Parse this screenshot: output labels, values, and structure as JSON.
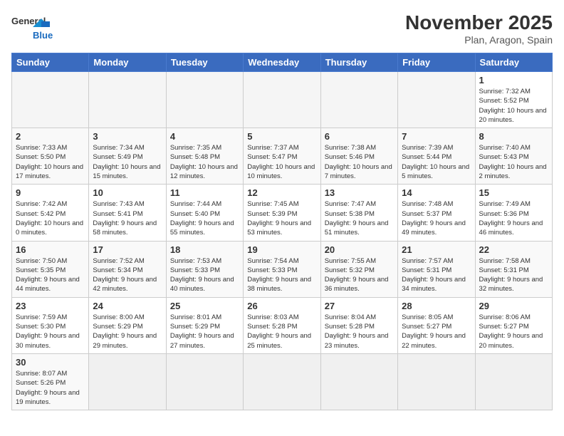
{
  "header": {
    "logo_general": "General",
    "logo_blue": "Blue",
    "title": "November 2025",
    "subtitle": "Plan, Aragon, Spain"
  },
  "days_of_week": [
    "Sunday",
    "Monday",
    "Tuesday",
    "Wednesday",
    "Thursday",
    "Friday",
    "Saturday"
  ],
  "weeks": [
    {
      "days": [
        {
          "num": "",
          "info": "",
          "empty": true
        },
        {
          "num": "",
          "info": "",
          "empty": true
        },
        {
          "num": "",
          "info": "",
          "empty": true
        },
        {
          "num": "",
          "info": "",
          "empty": true
        },
        {
          "num": "",
          "info": "",
          "empty": true
        },
        {
          "num": "",
          "info": "",
          "empty": true
        },
        {
          "num": "1",
          "info": "Sunrise: 7:32 AM\nSunset: 5:52 PM\nDaylight: 10 hours and 20 minutes.",
          "empty": false
        }
      ]
    },
    {
      "days": [
        {
          "num": "2",
          "info": "Sunrise: 7:33 AM\nSunset: 5:50 PM\nDaylight: 10 hours and 17 minutes.",
          "empty": false
        },
        {
          "num": "3",
          "info": "Sunrise: 7:34 AM\nSunset: 5:49 PM\nDaylight: 10 hours and 15 minutes.",
          "empty": false
        },
        {
          "num": "4",
          "info": "Sunrise: 7:35 AM\nSunset: 5:48 PM\nDaylight: 10 hours and 12 minutes.",
          "empty": false
        },
        {
          "num": "5",
          "info": "Sunrise: 7:37 AM\nSunset: 5:47 PM\nDaylight: 10 hours and 10 minutes.",
          "empty": false
        },
        {
          "num": "6",
          "info": "Sunrise: 7:38 AM\nSunset: 5:46 PM\nDaylight: 10 hours and 7 minutes.",
          "empty": false
        },
        {
          "num": "7",
          "info": "Sunrise: 7:39 AM\nSunset: 5:44 PM\nDaylight: 10 hours and 5 minutes.",
          "empty": false
        },
        {
          "num": "8",
          "info": "Sunrise: 7:40 AM\nSunset: 5:43 PM\nDaylight: 10 hours and 2 minutes.",
          "empty": false
        }
      ]
    },
    {
      "days": [
        {
          "num": "9",
          "info": "Sunrise: 7:42 AM\nSunset: 5:42 PM\nDaylight: 10 hours and 0 minutes.",
          "empty": false
        },
        {
          "num": "10",
          "info": "Sunrise: 7:43 AM\nSunset: 5:41 PM\nDaylight: 9 hours and 58 minutes.",
          "empty": false
        },
        {
          "num": "11",
          "info": "Sunrise: 7:44 AM\nSunset: 5:40 PM\nDaylight: 9 hours and 55 minutes.",
          "empty": false
        },
        {
          "num": "12",
          "info": "Sunrise: 7:45 AM\nSunset: 5:39 PM\nDaylight: 9 hours and 53 minutes.",
          "empty": false
        },
        {
          "num": "13",
          "info": "Sunrise: 7:47 AM\nSunset: 5:38 PM\nDaylight: 9 hours and 51 minutes.",
          "empty": false
        },
        {
          "num": "14",
          "info": "Sunrise: 7:48 AM\nSunset: 5:37 PM\nDaylight: 9 hours and 49 minutes.",
          "empty": false
        },
        {
          "num": "15",
          "info": "Sunrise: 7:49 AM\nSunset: 5:36 PM\nDaylight: 9 hours and 46 minutes.",
          "empty": false
        }
      ]
    },
    {
      "days": [
        {
          "num": "16",
          "info": "Sunrise: 7:50 AM\nSunset: 5:35 PM\nDaylight: 9 hours and 44 minutes.",
          "empty": false
        },
        {
          "num": "17",
          "info": "Sunrise: 7:52 AM\nSunset: 5:34 PM\nDaylight: 9 hours and 42 minutes.",
          "empty": false
        },
        {
          "num": "18",
          "info": "Sunrise: 7:53 AM\nSunset: 5:33 PM\nDaylight: 9 hours and 40 minutes.",
          "empty": false
        },
        {
          "num": "19",
          "info": "Sunrise: 7:54 AM\nSunset: 5:33 PM\nDaylight: 9 hours and 38 minutes.",
          "empty": false
        },
        {
          "num": "20",
          "info": "Sunrise: 7:55 AM\nSunset: 5:32 PM\nDaylight: 9 hours and 36 minutes.",
          "empty": false
        },
        {
          "num": "21",
          "info": "Sunrise: 7:57 AM\nSunset: 5:31 PM\nDaylight: 9 hours and 34 minutes.",
          "empty": false
        },
        {
          "num": "22",
          "info": "Sunrise: 7:58 AM\nSunset: 5:31 PM\nDaylight: 9 hours and 32 minutes.",
          "empty": false
        }
      ]
    },
    {
      "days": [
        {
          "num": "23",
          "info": "Sunrise: 7:59 AM\nSunset: 5:30 PM\nDaylight: 9 hours and 30 minutes.",
          "empty": false
        },
        {
          "num": "24",
          "info": "Sunrise: 8:00 AM\nSunset: 5:29 PM\nDaylight: 9 hours and 29 minutes.",
          "empty": false
        },
        {
          "num": "25",
          "info": "Sunrise: 8:01 AM\nSunset: 5:29 PM\nDaylight: 9 hours and 27 minutes.",
          "empty": false
        },
        {
          "num": "26",
          "info": "Sunrise: 8:03 AM\nSunset: 5:28 PM\nDaylight: 9 hours and 25 minutes.",
          "empty": false
        },
        {
          "num": "27",
          "info": "Sunrise: 8:04 AM\nSunset: 5:28 PM\nDaylight: 9 hours and 23 minutes.",
          "empty": false
        },
        {
          "num": "28",
          "info": "Sunrise: 8:05 AM\nSunset: 5:27 PM\nDaylight: 9 hours and 22 minutes.",
          "empty": false
        },
        {
          "num": "29",
          "info": "Sunrise: 8:06 AM\nSunset: 5:27 PM\nDaylight: 9 hours and 20 minutes.",
          "empty": false
        }
      ]
    },
    {
      "days": [
        {
          "num": "30",
          "info": "Sunrise: 8:07 AM\nSunset: 5:26 PM\nDaylight: 9 hours and 19 minutes.",
          "empty": false
        },
        {
          "num": "",
          "info": "",
          "empty": true
        },
        {
          "num": "",
          "info": "",
          "empty": true
        },
        {
          "num": "",
          "info": "",
          "empty": true
        },
        {
          "num": "",
          "info": "",
          "empty": true
        },
        {
          "num": "",
          "info": "",
          "empty": true
        },
        {
          "num": "",
          "info": "",
          "empty": true
        }
      ]
    }
  ]
}
